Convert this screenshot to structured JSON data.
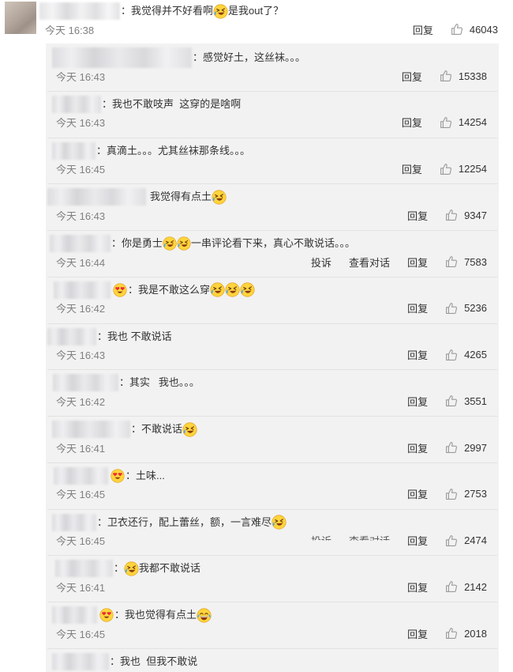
{
  "labels": {
    "reply": "回复"
  },
  "icons": {
    "like": "thumbs-up-icon",
    "laugh_cry": "laugh-cry-emoji",
    "heart_eyes": "heart-eyes-emoji",
    "joy": "tears-of-joy-emoji"
  },
  "colors": {
    "reply_area_bg": "#f2f2f2",
    "time_text": "#808080",
    "body_text": "#333333"
  },
  "top_comment": {
    "segments": [
      {
        "text": "：我觉得并不好看啊"
      },
      {
        "emoji": "laugh-cry-emoji"
      },
      {
        "text": "是我out了？"
      }
    ],
    "time": "今天 16:38",
    "likes": 46043
  },
  "replies": [
    {
      "segments": [
        {
          "text": "：感觉好土，这丝袜。。。"
        }
      ],
      "time": "今天 16:43",
      "likes": 15338
    },
    {
      "segments": [
        {
          "text": "：我也不敢吱声  这穿的是啥啊"
        }
      ],
      "time": "今天 16:43",
      "likes": 14254
    },
    {
      "segments": [
        {
          "text": "：真滴土。。。尤其丝袜那条线。。。"
        }
      ],
      "time": "今天 16:45",
      "likes": 12254
    },
    {
      "segments": [
        {
          "text": "我觉得有点土"
        },
        {
          "emoji": "laugh-cry-emoji"
        }
      ],
      "time": "今天 16:43",
      "likes": 9347
    },
    {
      "segments": [
        {
          "text": "：你是勇士"
        },
        {
          "emoji": "laugh-cry-emoji"
        },
        {
          "emoji": "laugh-cry-emoji"
        },
        {
          "text": "一串评论看下来，真心不敢说话。。。"
        }
      ],
      "time": "今天 16:44",
      "extra_actions": [
        "投诉",
        "查看对话"
      ],
      "likes": 7583
    },
    {
      "name_emoji": "heart-eyes-emoji",
      "segments": [
        {
          "text": "：我是不敢这么穿"
        },
        {
          "emoji": "laugh-cry-emoji"
        },
        {
          "emoji": "laugh-cry-emoji"
        },
        {
          "emoji": "laugh-cry-emoji"
        }
      ],
      "time": "今天 16:42",
      "likes": 5236
    },
    {
      "segments": [
        {
          "text": "：我也 不敢说话"
        }
      ],
      "time": "今天 16:43",
      "likes": 4265
    },
    {
      "segments": [
        {
          "text": "：其实   我也。。。"
        }
      ],
      "time": "今天 16:42",
      "likes": 3551
    },
    {
      "segments": [
        {
          "text": "：不敢说话"
        },
        {
          "emoji": "laugh-cry-emoji"
        }
      ],
      "time": "今天 16:41",
      "likes": 2997
    },
    {
      "name_emoji": "heart-eyes-emoji",
      "segments": [
        {
          "text": "：土味..."
        }
      ],
      "time": "今天 16:45",
      "likes": 2753
    },
    {
      "segments": [
        {
          "text": "：卫衣还行，配上蕾丝，额，一言难尽"
        },
        {
          "emoji": "laugh-cry-emoji"
        }
      ],
      "time": "今天 16:45",
      "extra_actions": [
        "投诉",
        "查看对话"
      ],
      "likes": 2474
    },
    {
      "segments": [
        {
          "text": "："
        },
        {
          "emoji": "laugh-cry-emoji"
        },
        {
          "text": "我都不敢说话"
        }
      ],
      "time": "今天 16:41",
      "likes": 2142
    },
    {
      "name_emoji": "heart-eyes-emoji",
      "segments": [
        {
          "text": "：我也觉得有点土"
        },
        {
          "emoji": "tears-of-joy-emoji"
        }
      ],
      "time": "今天 16:45",
      "likes": 2018
    },
    {
      "segments": [
        {
          "text": "：我也  但我不敢说"
        }
      ]
    }
  ]
}
